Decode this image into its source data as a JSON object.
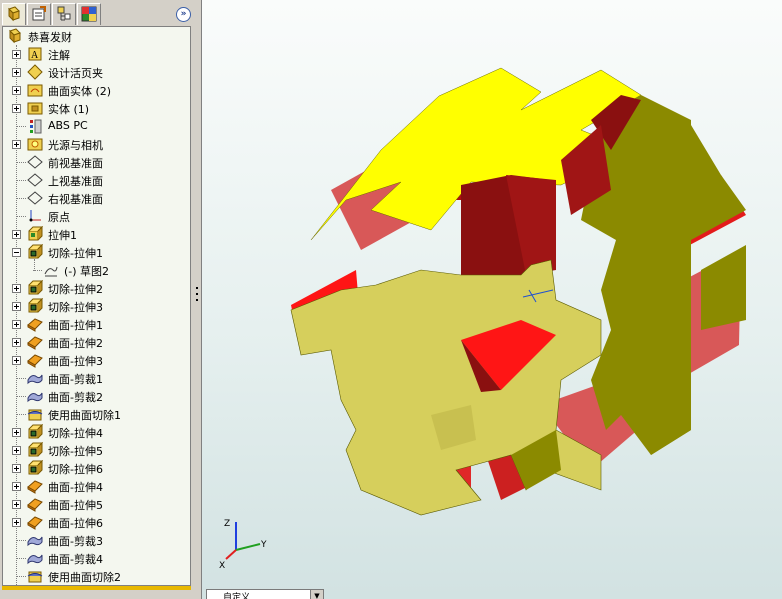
{
  "tree": {
    "root_label": "恭喜发财",
    "items": [
      {
        "label": "注解",
        "icon": "annotation-icon",
        "expander": "plus"
      },
      {
        "label": "设计活页夹",
        "icon": "design-binder-icon",
        "expander": "plus"
      },
      {
        "label": "曲面实体 (2)",
        "icon": "surface-bodies-icon",
        "expander": "plus"
      },
      {
        "label": "实体 (1)",
        "icon": "solid-bodies-icon",
        "expander": "plus"
      },
      {
        "label": "ABS PC",
        "icon": "material-icon",
        "expander": "none"
      },
      {
        "label": "光源与相机",
        "icon": "lights-cameras-icon",
        "expander": "plus"
      },
      {
        "label": "前视基准面",
        "icon": "plane-icon",
        "expander": "none"
      },
      {
        "label": "上视基准面",
        "icon": "plane-icon",
        "expander": "none"
      },
      {
        "label": "右视基准面",
        "icon": "plane-icon",
        "expander": "none"
      },
      {
        "label": "原点",
        "icon": "origin-icon",
        "expander": "none"
      },
      {
        "label": "拉伸1",
        "icon": "extrude-icon",
        "expander": "plus"
      },
      {
        "label": "切除-拉伸1",
        "icon": "cut-extrude-icon",
        "expander": "minus"
      },
      {
        "label": "(-) 草图2",
        "icon": "sketch-icon",
        "expander": "none",
        "child": true
      },
      {
        "label": "切除-拉伸2",
        "icon": "cut-extrude-icon",
        "expander": "plus"
      },
      {
        "label": "切除-拉伸3",
        "icon": "cut-extrude-icon",
        "expander": "plus"
      },
      {
        "label": "曲面-拉伸1",
        "icon": "surface-extrude-icon",
        "expander": "plus"
      },
      {
        "label": "曲面-拉伸2",
        "icon": "surface-extrude-icon",
        "expander": "plus"
      },
      {
        "label": "曲面-拉伸3",
        "icon": "surface-extrude-icon",
        "expander": "plus"
      },
      {
        "label": "曲面-剪裁1",
        "icon": "surface-trim-icon",
        "expander": "none"
      },
      {
        "label": "曲面-剪裁2",
        "icon": "surface-trim-icon",
        "expander": "none"
      },
      {
        "label": "使用曲面切除1",
        "icon": "cut-with-surface-icon",
        "expander": "none"
      },
      {
        "label": "切除-拉伸4",
        "icon": "cut-extrude-icon",
        "expander": "plus"
      },
      {
        "label": "切除-拉伸5",
        "icon": "cut-extrude-icon",
        "expander": "plus"
      },
      {
        "label": "切除-拉伸6",
        "icon": "cut-extrude-icon",
        "expander": "plus"
      },
      {
        "label": "曲面-拉伸4",
        "icon": "surface-extrude-icon",
        "expander": "plus"
      },
      {
        "label": "曲面-拉伸5",
        "icon": "surface-extrude-icon",
        "expander": "plus"
      },
      {
        "label": "曲面-拉伸6",
        "icon": "surface-extrude-icon",
        "expander": "plus"
      },
      {
        "label": "曲面-剪裁3",
        "icon": "surface-trim-icon",
        "expander": "none"
      },
      {
        "label": "曲面-剪裁4",
        "icon": "surface-trim-icon",
        "expander": "none"
      },
      {
        "label": "使用曲面切除2",
        "icon": "cut-with-surface-icon",
        "expander": "none"
      }
    ]
  },
  "tabs": [
    "feature-manager-icon",
    "property-manager-icon",
    "configuration-manager-icon",
    "display-manager-icon"
  ],
  "triad": {
    "x": "X",
    "y": "Y",
    "z": "Z"
  },
  "view_select": {
    "value": "自定义"
  },
  "colors": {
    "model_yellow": "#d6cf5c",
    "model_dark": "#8b8a00",
    "cut_red": "#e31b1b",
    "cut_darkred": "#a00f0f",
    "top_yellow": "#ffff00"
  }
}
